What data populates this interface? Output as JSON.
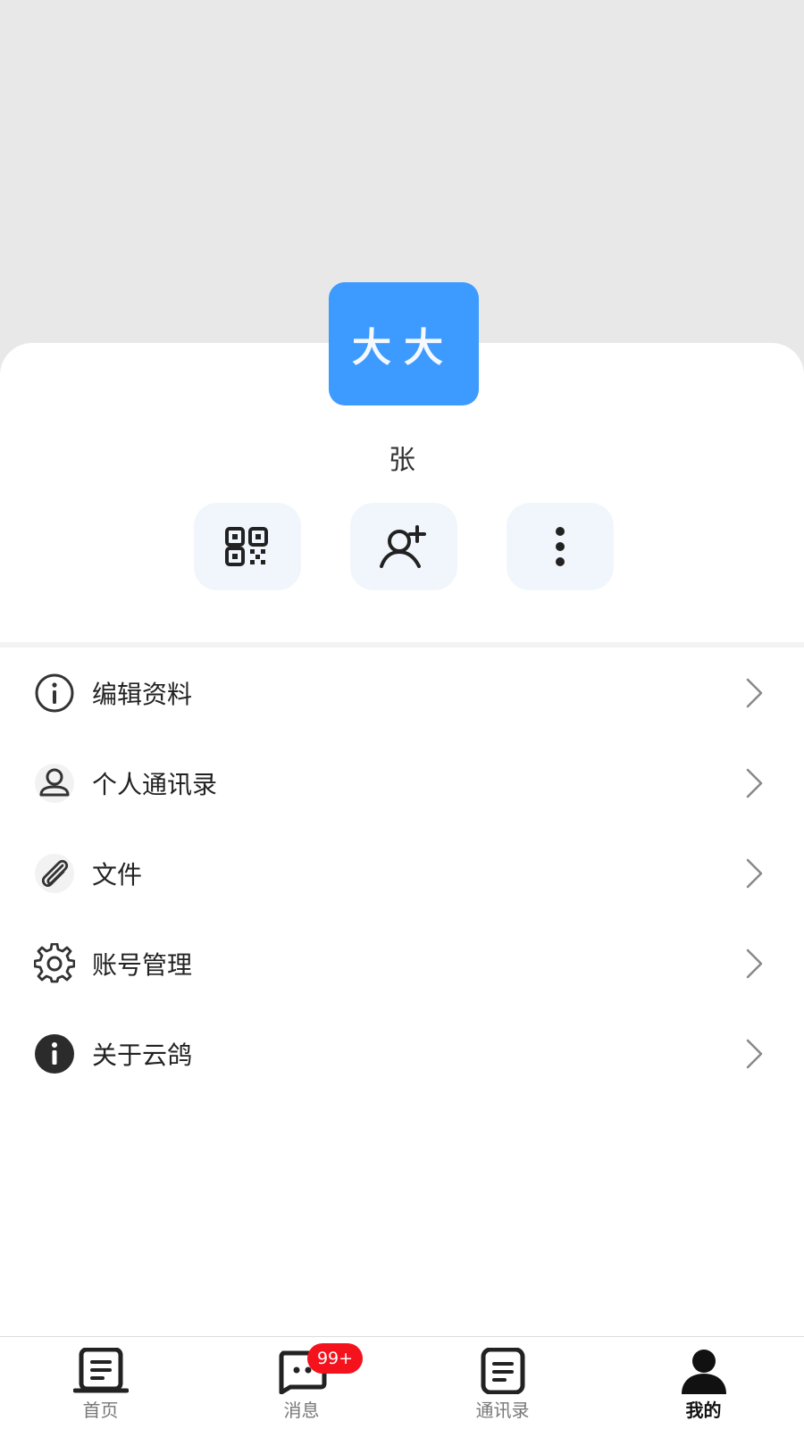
{
  "profile": {
    "avatar_text": "大大",
    "avatar_color": "#3d9bff",
    "username": "张"
  },
  "actions": [
    {
      "icon": "qr-code-icon"
    },
    {
      "icon": "add-user-icon"
    },
    {
      "icon": "more-vertical-icon"
    }
  ],
  "menu": {
    "items": [
      {
        "label": "编辑资料",
        "icon": "info-outline-icon"
      },
      {
        "label": "个人通讯录",
        "icon": "person-icon"
      },
      {
        "label": "文件",
        "icon": "paperclip-icon"
      },
      {
        "label": "账号管理",
        "icon": "gear-icon"
      },
      {
        "label": "关于云鸽",
        "icon": "info-filled-icon"
      }
    ]
  },
  "tabbar": {
    "items": [
      {
        "label": "首页",
        "icon": "home-icon",
        "active": false
      },
      {
        "label": "消息",
        "icon": "message-icon",
        "active": false
      },
      {
        "label": "通讯录",
        "icon": "contacts-icon",
        "active": false
      },
      {
        "label": "我的",
        "icon": "profile-icon",
        "active": true
      }
    ],
    "badge": "99+",
    "badge_color": "#f4121d"
  }
}
